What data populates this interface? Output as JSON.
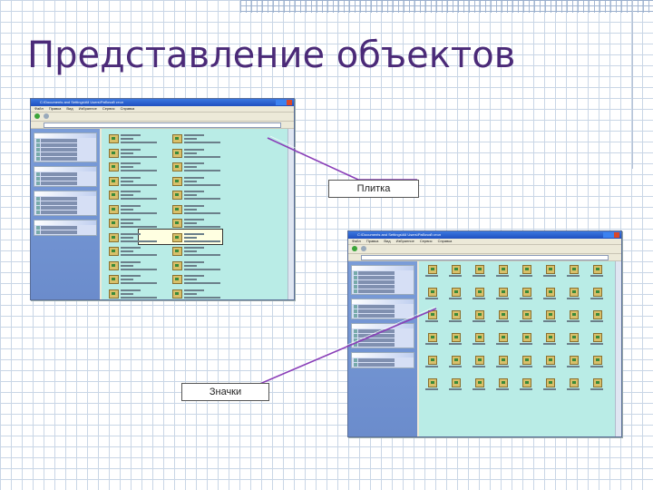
{
  "slide": {
    "title": "Представление объектов"
  },
  "callouts": {
    "tiles_label": "Плитка",
    "icons_label": "Значки"
  },
  "window_tiles": {
    "title_bar": "C:\\Documents and Settings\\All Users\\Рабочий стол",
    "menu": [
      "Файл",
      "Правка",
      "Вид",
      "Избранное",
      "Сервис",
      "Справка"
    ],
    "tile_count": 24,
    "view_mode": "tiles"
  },
  "window_icons": {
    "title_bar": "C:\\Documents and Settings\\All Users\\Рабочий стол",
    "menu": [
      "Файл",
      "Правка",
      "Вид",
      "Избранное",
      "Сервис",
      "Справка"
    ],
    "icon_count": 48,
    "view_mode": "icons"
  },
  "colors": {
    "title": "#4b2a78",
    "content_background": "#b9ece6",
    "callout_line": "#8a3fb8"
  }
}
